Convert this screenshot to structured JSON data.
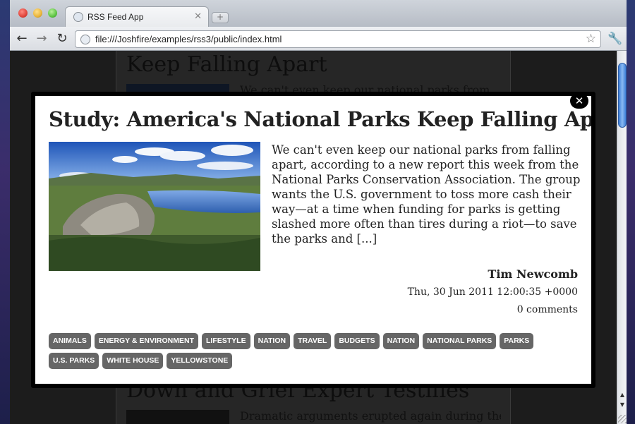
{
  "browser": {
    "tab_title": "RSS Feed App",
    "tab_close": "✕",
    "new_tab": "+",
    "url": "file:///Joshfire/examples/rss3/public/index.html",
    "back": "←",
    "forward": "→",
    "reload": "↻",
    "star": "☆",
    "menu": "🔧"
  },
  "background_page": {
    "top_title": "Keep Falling Apart",
    "top_excerpt": "We can't even keep our national parks from",
    "bottom_title": "Down and Grief Expert Testifies",
    "bottom_excerpt": "Dramatic arguments erupted again during the"
  },
  "modal": {
    "close_label": "✕",
    "title": "Study: America's National Parks Keep Falling Apart",
    "body": "We can't even keep our national parks from falling apart, according to a new report this week from the National Parks Conservation Association. The group wants the U.S. government to toss more cash their way—at a time when funding for parks is getting slashed more often than tires during a riot—to save the parks and [...]",
    "author": "Tim Newcomb",
    "date": "Thu, 30 Jun 2011 12:00:35 +0000",
    "comments": "0 comments",
    "tags": [
      "Animals",
      "Energy & Environment",
      "Lifestyle",
      "Nation",
      "Travel",
      "Budgets",
      "Nation",
      "National Parks",
      "Parks",
      "U.S. Parks",
      "White House",
      "Yellowstone"
    ]
  },
  "colors": {
    "tag_bg": "#666666",
    "modal_frame": "#000000",
    "page_bg": "#1c1c1c"
  }
}
